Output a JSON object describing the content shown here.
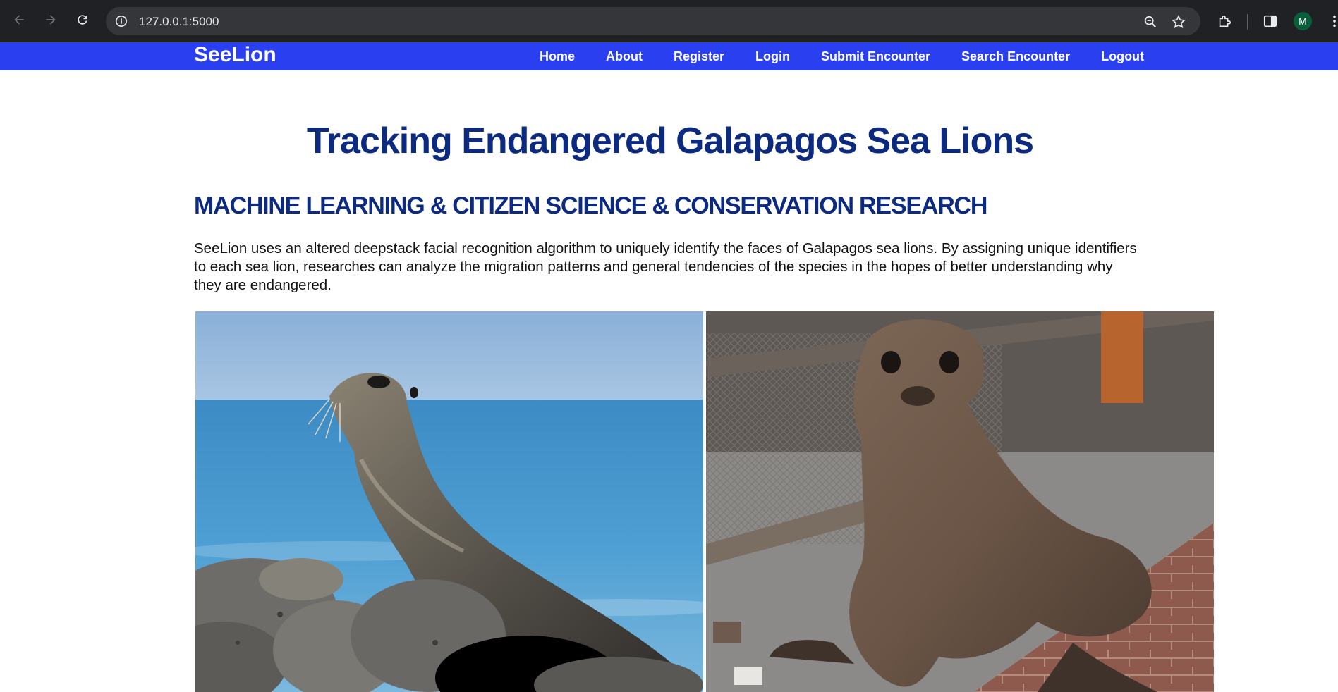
{
  "browser": {
    "url": "127.0.0.1:5000",
    "profile_initial": "M",
    "icons": [
      "back-arrow-icon",
      "forward-arrow-icon",
      "reload-icon",
      "site-info-icon",
      "zoom-icon",
      "bookmark-star-icon",
      "extensions-puzzle-icon",
      "side-panel-icon",
      "more-menu-icon"
    ]
  },
  "navbar": {
    "brand": "SeeLion",
    "links": [
      "Home",
      "About",
      "Register",
      "Login",
      "Submit Encounter",
      "Search Encounter",
      "Logout"
    ],
    "background_color": "#2a3ff0"
  },
  "main": {
    "title": "Tracking Endangered Galapagos Sea Lions",
    "subtitle": "MACHINE LEARNING & CITIZEN SCIENCE & CONSERVATION RESEARCH",
    "intro": "SeeLion uses an altered deepstack facial recognition algorithm to uniquely identify the faces of Galapagos sea lions. By assigning unique identifiers to each sea lion, researches can analyze the migration patterns and general tendencies of the species in the hopes of better understanding why they are endangered.",
    "heading_color": "#0c2a80",
    "images": [
      {
        "subject": "sea lion on rocks by the ocean"
      },
      {
        "subject": "sea lion sitting on brick pavement by a fence"
      }
    ]
  }
}
